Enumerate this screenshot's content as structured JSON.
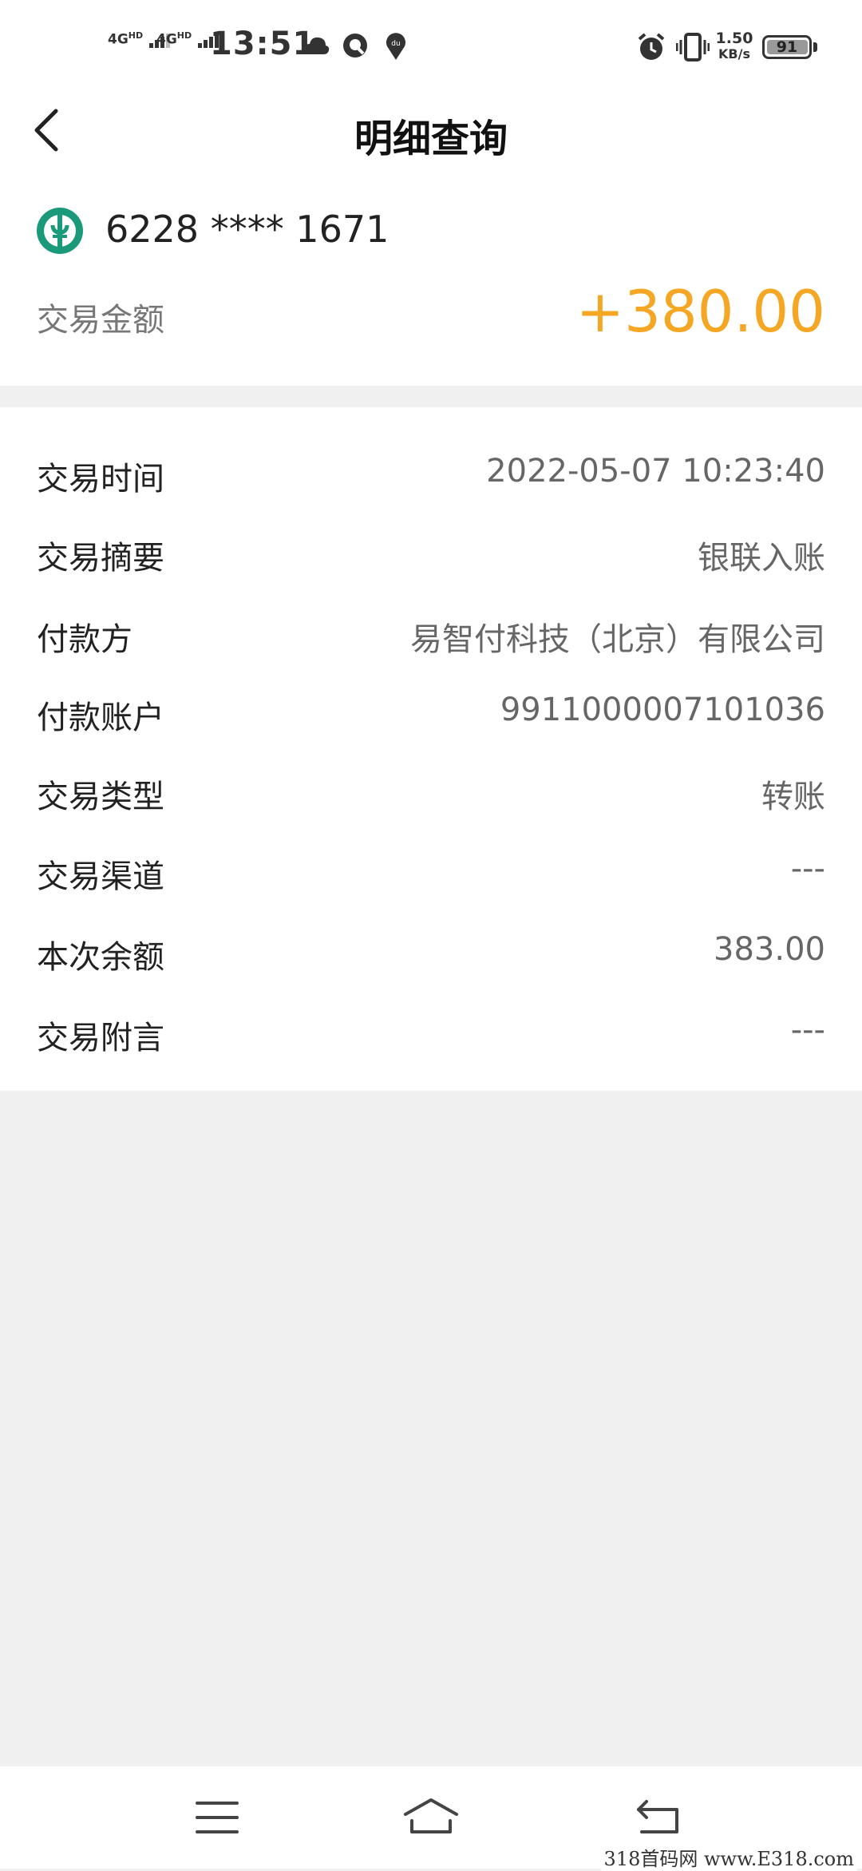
{
  "status_bar": {
    "network_1": "4G",
    "network_1_sup": "HD",
    "network_2": "4G",
    "network_2_sup": "HD",
    "time": "13:51",
    "speed_value": "1.50",
    "speed_unit": "KB/s",
    "battery": "91"
  },
  "header": {
    "title": "明细查询"
  },
  "summary": {
    "card_number": "6228 **** 1671",
    "amount_label": "交易金额",
    "amount_value": "+380.00",
    "amount_color": "#f5a623"
  },
  "details": [
    {
      "label": "交易时间",
      "value": "2022-05-07 10:23:40"
    },
    {
      "label": "交易摘要",
      "value": "银联入账"
    },
    {
      "label": "付款方",
      "value": "易智付科技（北京）有限公司"
    },
    {
      "label": "付款账户",
      "value": "9911000007101036"
    },
    {
      "label": "交易类型",
      "value": "转账"
    },
    {
      "label": "交易渠道",
      "value": "---"
    },
    {
      "label": "本次余额",
      "value": "383.00"
    },
    {
      "label": "交易附言",
      "value": "---"
    }
  ],
  "icons": {
    "back": "chevron-left-icon",
    "bank_logo": "abc-bank-logo",
    "menu": "menu-icon",
    "home": "home-icon",
    "return": "return-icon"
  },
  "watermark": "318首码网 www.E318.com"
}
